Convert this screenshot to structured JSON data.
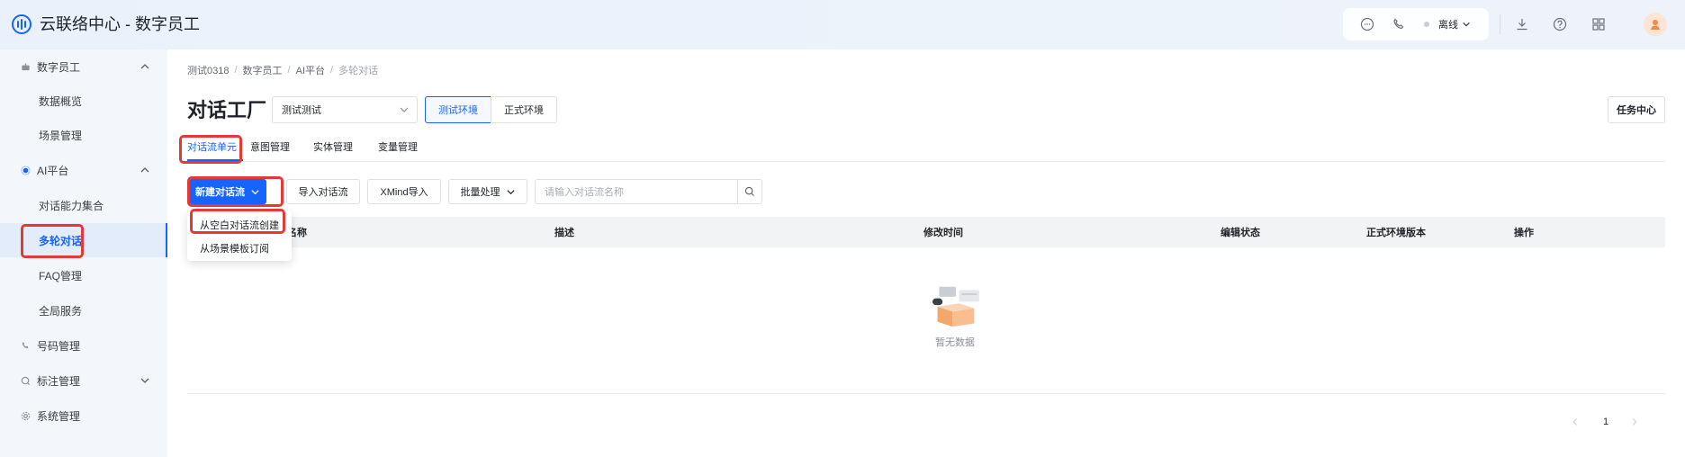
{
  "header": {
    "title": "云联络中心 - 数字员工",
    "status": "离线",
    "icons": [
      "chat-icon",
      "phone-icon",
      "download-icon",
      "help-icon",
      "apps-icon"
    ]
  },
  "sidebar": {
    "groups": [
      {
        "label": "数字员工",
        "icon": "robot-icon",
        "expanded": true,
        "items": [
          {
            "label": "数据概览"
          },
          {
            "label": "场景管理"
          }
        ]
      },
      {
        "label": "AI平台",
        "icon": "ai-dot-icon",
        "expanded": true,
        "items": [
          {
            "label": "对话能力集合"
          },
          {
            "label": "多轮对话",
            "active": true
          },
          {
            "label": "FAQ管理"
          },
          {
            "label": "全局服务"
          }
        ]
      },
      {
        "label": "号码管理",
        "icon": "phone-icon"
      },
      {
        "label": "标注管理",
        "icon": "tag-icon",
        "expanded": false
      },
      {
        "label": "系统管理",
        "icon": "gear-icon"
      }
    ]
  },
  "breadcrumb": [
    "测试0318",
    "AI平台",
    "多轮对话"
  ],
  "breadcrumb_mid": "数字员工",
  "page": {
    "title": "对话工厂",
    "select_value": "测试测试",
    "env_test": "测试环境",
    "env_prod": "正式环境",
    "task_center": "任务中心"
  },
  "tabs": [
    "对话流单元",
    "意图管理",
    "实体管理",
    "变量管理"
  ],
  "toolbar": {
    "new_flow": "新建对话流",
    "import_flow": "导入对话流",
    "xmind_import": "XMind导入",
    "batch": "批量处理",
    "search_placeholder": "请输入对话流名称"
  },
  "table": {
    "col_name": "流名称",
    "columns": [
      "描述",
      "修改时间",
      "编辑状态",
      "正式环境版本",
      "操作"
    ],
    "empty_text": "暂无数据"
  },
  "dropdown": [
    "从空白对话流创建",
    "从场景模板订阅"
  ],
  "pagination": {
    "current": "1"
  },
  "colors": {
    "primary": "#1664ff",
    "highlight": "#e53935"
  }
}
